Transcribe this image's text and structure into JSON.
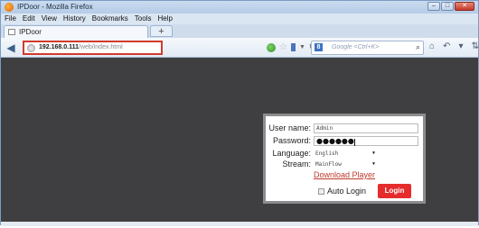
{
  "window": {
    "title": "IPDoor - Mozilla Firefox",
    "min_label": "–",
    "max_label": "□",
    "close_label": "✕"
  },
  "menu": [
    "File",
    "Edit",
    "View",
    "History",
    "Bookmarks",
    "Tools",
    "Help"
  ],
  "tab": {
    "label": "IPDoor",
    "new_tab_label": "+"
  },
  "nav": {
    "url_host": "192.168.0.111",
    "url_path": "/web/index.html",
    "search_placeholder": "Google <Ctrl+K>"
  },
  "login": {
    "username_label": "User name:",
    "username_value": "Admin",
    "password_label": "Password:",
    "password_masked": "●●●●●●",
    "language_label": "Language:",
    "language_value": "English",
    "stream_label": "Stream:",
    "stream_value": "MainFlow",
    "download_link": "Download Player",
    "auto_login_label": "Auto Login",
    "auto_login_checked": false,
    "login_button": "Login"
  },
  "colors": {
    "url_highlight": "#d23a2c",
    "login_button": "#e52b2b",
    "download_link": "#c0392b",
    "content_bg": "#3f3f41"
  }
}
